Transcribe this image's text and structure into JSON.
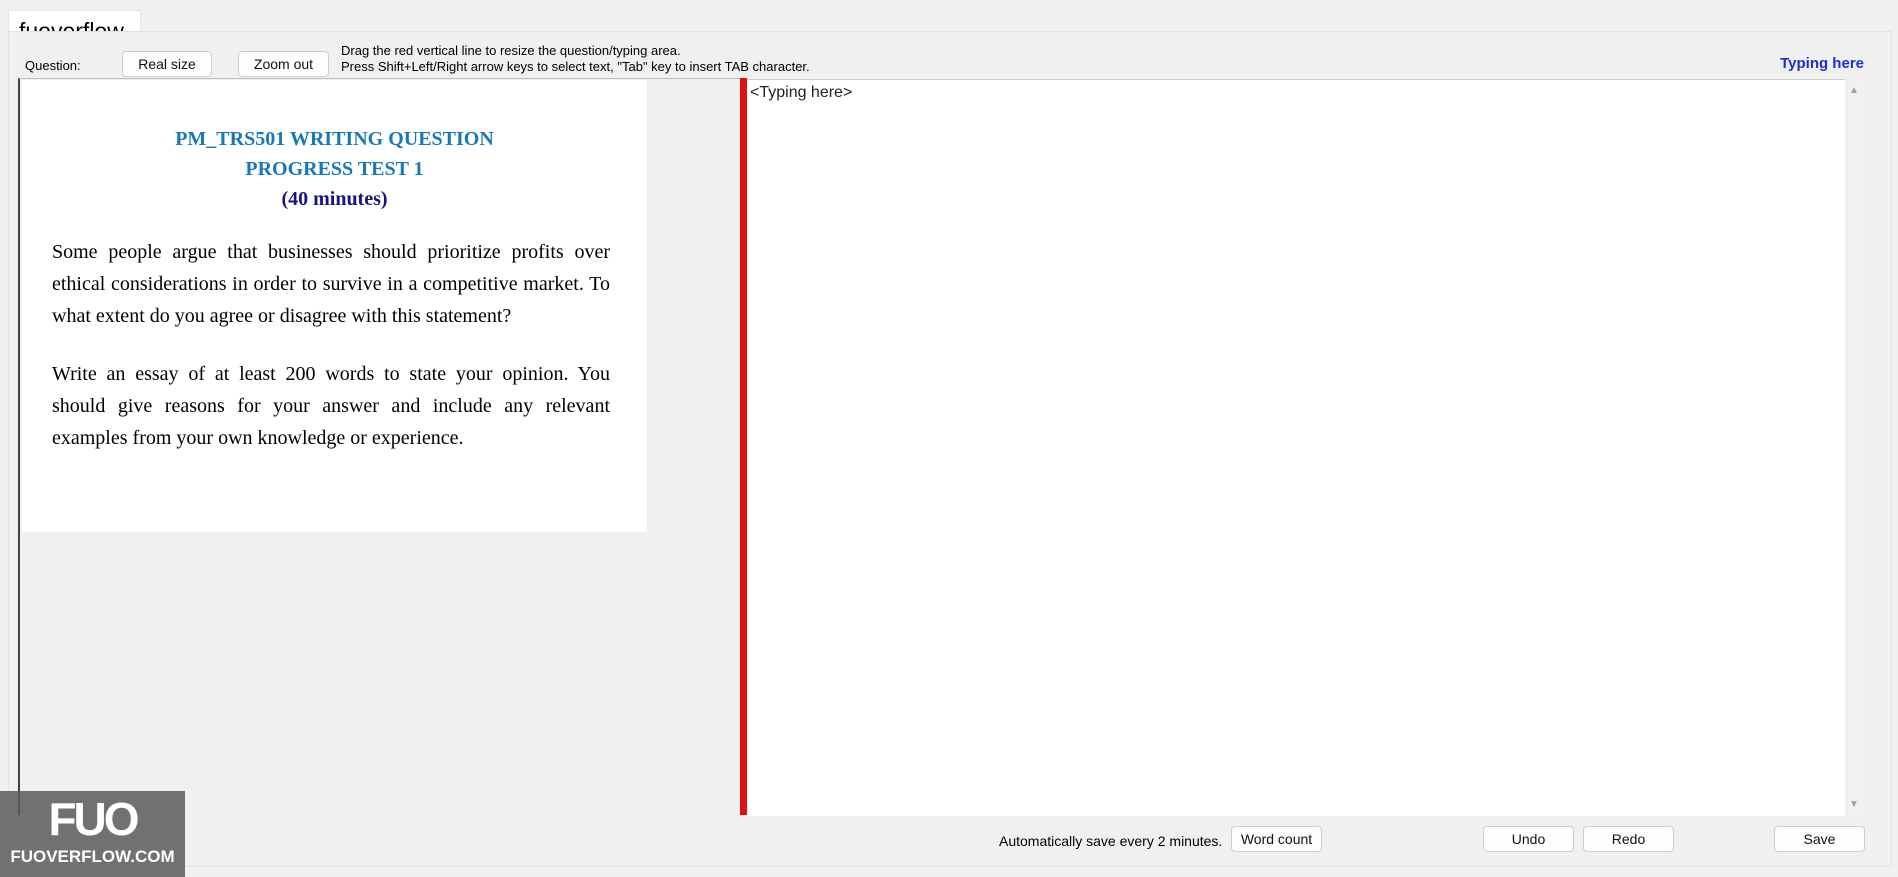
{
  "app": {
    "tab_title": "fuoverflow"
  },
  "toolbar": {
    "question_label": "Question:",
    "real_size_label": "Real size",
    "zoom_out_label": "Zoom out",
    "hint_line1": "Drag the red vertical line to resize the question/typing area.",
    "hint_line2": "Press Shift+Left/Right arrow keys to select text, \"Tab\" key to insert TAB character.",
    "typing_title": "Typing here"
  },
  "question": {
    "title_line1": "PM_TRS501 WRITING QUESTION",
    "title_line2": "PROGRESS TEST 1",
    "title_line3": "(40 minutes)",
    "paragraph1": "Some people argue that businesses should prioritize profits over ethical considerations in order to survive in a competitive market. To what extent do you agree or disagree with this statement?",
    "paragraph2": "Write an essay of at least 200 words to state your opinion. You should give reasons for your answer and include any relevant examples from your own knowledge or experience."
  },
  "editor": {
    "placeholder_text": "<Typing here>"
  },
  "footer": {
    "autosave_text": "Automatically save every 2 minutes.",
    "word_count_label": "Word count",
    "undo_label": "Undo",
    "redo_label": "Redo",
    "save_label": "Save"
  },
  "watermark": {
    "logo_mark": "FUO",
    "logo_text": "FUOVERFLOW.COM"
  },
  "colors": {
    "divider": "#e11010",
    "title_blue": "#1a78b4",
    "subtitle_navy": "#16167a",
    "typing_title_blue": "#1f2fd0"
  },
  "icons": {
    "scroll_up": "triangle-up-icon",
    "scroll_down": "triangle-down-icon"
  }
}
